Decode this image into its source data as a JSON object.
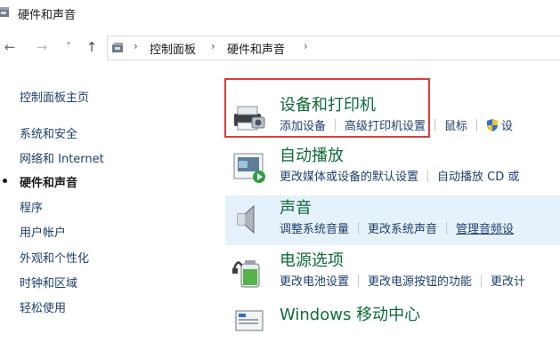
{
  "window": {
    "title": "硬件和声音"
  },
  "nav": {
    "back": "←",
    "forward": "→",
    "recent": "˅",
    "up": "↑",
    "separator": "›",
    "breadcrumb": [
      "控制面板",
      "硬件和声音"
    ]
  },
  "sidebar": {
    "items": [
      {
        "label": "控制面板主页"
      },
      {
        "label": "系统和安全"
      },
      {
        "label": "网络和 Internet"
      },
      {
        "label": "硬件和声音",
        "current": true
      },
      {
        "label": "程序"
      },
      {
        "label": "用户帐户"
      },
      {
        "label": "外观和个性化"
      },
      {
        "label": "时钟和区域"
      },
      {
        "label": "轻松使用"
      }
    ]
  },
  "categories": [
    {
      "name": "设备和打印机",
      "icon": "printer-icon",
      "links": [
        "添加设备",
        "高级打印机设置",
        "鼠标",
        "设"
      ]
    },
    {
      "name": "自动播放",
      "icon": "autoplay-icon",
      "links": [
        "更改媒体或设备的默认设置",
        "自动播放 CD 或"
      ]
    },
    {
      "name": "声音",
      "icon": "speaker-icon",
      "links": [
        "调整系统音量",
        "更改系统声音",
        "管理音频设"
      ]
    },
    {
      "name": "电源选项",
      "icon": "power-icon",
      "links": [
        "更改电池设置",
        "更改电源按钮的功能",
        "更改计"
      ]
    },
    {
      "name": "Windows 移动中心",
      "icon": "mobility-icon",
      "links": []
    }
  ],
  "colors": {
    "highlight": "#e5f1fb",
    "category_title": "#0f6b3a",
    "link": "#1e3f6e",
    "annotation_box": "#e03b3b"
  }
}
